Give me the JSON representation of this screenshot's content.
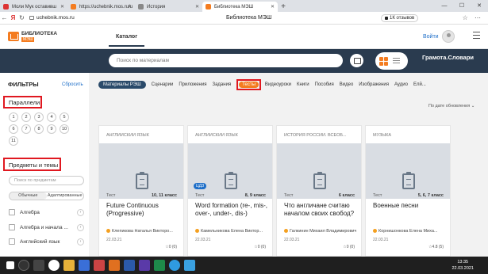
{
  "browser": {
    "tabs": [
      {
        "label": "Моли Мук оставивш",
        "fav": "#d33"
      },
      {
        "label": "https://uchebnik.mos.ru/u",
        "fav": "#f47c20"
      },
      {
        "label": "История",
        "fav": "#888"
      },
      {
        "label": "Библиотека МЭШ",
        "fav": "#f47c20"
      }
    ],
    "new_tab": "+",
    "url": "uchebnik.mos.ru",
    "page_title": "Библиотека МЭШ",
    "reviews": "1К отзывов"
  },
  "header": {
    "logo_line1": "БИБЛИОТЕКА",
    "logo_line2": "МЭШ",
    "catalog": "Каталог",
    "login": "Войти"
  },
  "search": {
    "placeholder": "Поиск по материалам",
    "grammar": "Грамота.Словари"
  },
  "filters": {
    "title": "ФИЛЬТРЫ",
    "reset": "Сбросить",
    "parallels_title": "Параллели",
    "grades": [
      "1",
      "2",
      "3",
      "4",
      "5",
      "6",
      "7",
      "8",
      "9",
      "10",
      "11"
    ],
    "subjects_title": "Предметы и темы",
    "subject_search_placeholder": "Поиск по предметам",
    "mode_tabs": [
      "Обычные",
      "Адаптированные"
    ],
    "subjects": [
      "Алгебра",
      "Алгебра и начала ...",
      "Английский язык"
    ]
  },
  "chips": [
    "Материалы РЭШ",
    "Сценарии",
    "Приложения",
    "Задания",
    "Тесты",
    "Видеоуроки",
    "Книги",
    "Пособия",
    "Видео",
    "Изображения",
    "Аудио",
    "Елй..."
  ],
  "sort": "По дате обновления",
  "cards": [
    {
      "subject": "АНГЛИЙСКИЙ ЯЗЫК",
      "kind": "Тест",
      "grade": "10, 11 класс",
      "title": "Future Continuous (Progressive)",
      "author": "Клепикова Наталья Викторо...",
      "date": "22.03.21",
      "rating": "0 (0)",
      "cdz": ""
    },
    {
      "subject": "АНГЛИЙСКИЙ ЯЗЫК",
      "kind": "Тест",
      "grade": "8, 9 класс",
      "title": "Word formation (re-, mis-, over-, under-, dis-)",
      "author": "Камельникова Елена Виктор...",
      "date": "22.03.21",
      "rating": "0 (0)",
      "cdz": "ЦДЗ"
    },
    {
      "subject": "ИСТОРИЯ РОССИИ. ВСЕОБ...",
      "kind": "Тест",
      "grade": "6 класс",
      "title": "Что англичане считаю началом своих свобод?",
      "author": "Галкинин Михаил Владимирович",
      "date": "22.03.21",
      "rating": "0 (0)",
      "cdz": ""
    },
    {
      "subject": "МУЗЫКА",
      "kind": "Тест",
      "grade": "5, 6, 7 класс",
      "title": "Военные песни",
      "author": "Корнишонкова Елена Миха...",
      "date": "22.03.21",
      "rating": "4.8 (5)",
      "cdz": ""
    }
  ],
  "taskbar": {
    "time": "13:35",
    "date": "22.03.2021"
  }
}
